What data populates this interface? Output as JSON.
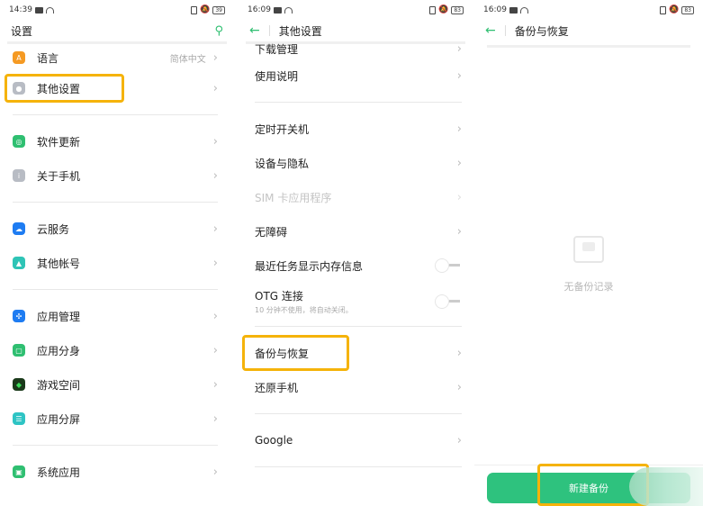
{
  "screen1": {
    "status": {
      "time": "14:39",
      "battery": "39"
    },
    "header": {
      "title": "设置",
      "search_icon": "search-icon"
    },
    "items": [
      {
        "label": "语言",
        "value": "简体中文",
        "icon": "language-icon",
        "color": "#f59a23"
      },
      {
        "label": "其他设置",
        "icon": "other-settings-icon",
        "color": "#b8bcc4",
        "highlighted": true
      },
      {
        "label": "软件更新",
        "icon": "update-icon",
        "color": "#2fbf71"
      },
      {
        "label": "关于手机",
        "icon": "info-icon",
        "color": "#b8bcc4"
      },
      {
        "label": "云服务",
        "icon": "cloud-icon",
        "color": "#1e7cf2"
      },
      {
        "label": "其他帐号",
        "icon": "account-icon",
        "color": "#2ec4b6"
      },
      {
        "label": "应用管理",
        "icon": "app-manage-icon",
        "color": "#1e7cf2"
      },
      {
        "label": "应用分身",
        "icon": "app-clone-icon",
        "color": "#2fbf71"
      },
      {
        "label": "游戏空间",
        "icon": "game-space-icon",
        "color": "#1a3a1a"
      },
      {
        "label": "应用分屏",
        "icon": "split-screen-icon",
        "color": "#2ec4c4"
      },
      {
        "label": "系统应用",
        "icon": "system-apps-icon",
        "color": "#2fbf71"
      }
    ]
  },
  "screen2": {
    "status": {
      "time": "16:09",
      "battery": "83"
    },
    "header": {
      "title": "其他设置"
    },
    "items": [
      {
        "label": "下载管理"
      },
      {
        "label": "使用说明"
      },
      {
        "label": "定时开关机"
      },
      {
        "label": "设备与隐私"
      },
      {
        "label": "SIM 卡应用程序",
        "disabled": true
      },
      {
        "label": "无障碍"
      },
      {
        "label": "最近任务显示内存信息",
        "toggle": false
      },
      {
        "label": "OTG 连接",
        "sub": "10 分钟不使用，将自动关闭。",
        "toggle": false
      },
      {
        "label": "备份与恢复",
        "highlighted": true
      },
      {
        "label": "还原手机"
      },
      {
        "label": "Google"
      }
    ]
  },
  "screen3": {
    "status": {
      "time": "16:09",
      "battery": "83"
    },
    "header": {
      "title": "备份与恢复"
    },
    "empty_text": "无备份记录",
    "new_backup_button": "新建备份"
  },
  "colors": {
    "accent": "#2fbf71",
    "highlight": "#f5b30a"
  }
}
